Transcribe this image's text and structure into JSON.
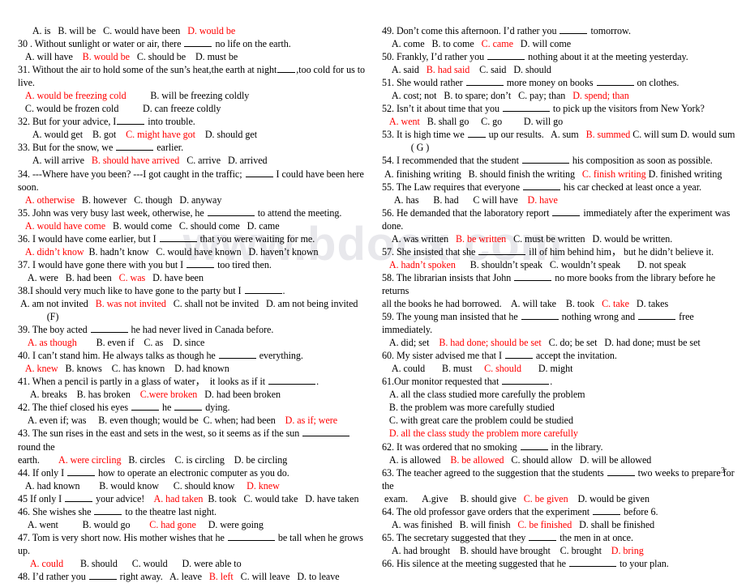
{
  "document": {
    "watermark": "www.bdocx.com",
    "page_number": "3",
    "accent_color": "#ff0000"
  },
  "left_column": [
    {
      "text": "      A. is   B. will be   C. would have been   ",
      "answer": "D. would be"
    },
    {
      "text": "30 . Without sunlight or water or air, there _____ no life on the earth."
    },
    {
      "text": "   A. will have    ",
      "answer": "B. would be",
      "tail": "   C. should be    D. must be"
    },
    {
      "text": "31. Without the air to hold some of the sun’s heat,the earth at night___,too cold for us to live."
    },
    {
      "answer": "   A. would be freezing cold",
      "tail": "          B. will be freezing coldly"
    },
    {
      "text": "   C. would be frozen cold          D. can freeze coldly"
    },
    {
      "text": "32. But for your advice, I_____ into trouble."
    },
    {
      "text": "      A. would get    B. got    ",
      "answer": "C. might have got",
      "tail": "    D. should get"
    },
    {
      "text": "33. But for the snow, we _______ earlier."
    },
    {
      "text": "      A. will arrive   ",
      "answer": "B. should have arrived",
      "tail": "   C. arrive   D. arrived"
    },
    {
      "text": "34. ---Where have you been? ---I got caught in the traffic; _____ I could have been here soon."
    },
    {
      "answer": "   A. otherwise",
      "tail": "   B. however   C. though   D. anyway"
    },
    {
      "text": "35. John was very busy last week, otherwise, he _________ to attend the meeting."
    },
    {
      "answer": "   A. would have come",
      "tail": "   B. would come   C. should come   D. came"
    },
    {
      "text": "36. I would have come earlier, but I ______ that you were waiting for me."
    },
    {
      "answer": "   A. didn’t know",
      "tail": "  B. hadn’t know   C. would have known   D. haven’t known"
    },
    {
      "text": "37. I would have gone there with you but I _____ too tired then."
    },
    {
      "text": "    A. were   B. had been   ",
      "answer": "C. was",
      "tail": "   D. have been"
    },
    {
      "text": "38.I should very much like to have gone to the party but I ______."
    },
    {
      "text": " A. am not invited   ",
      "answer": "B. was not invited",
      "tail": "   C. shall not be invited   D. am not being invited"
    },
    {
      "text": "            (F)"
    },
    {
      "text": "39. The boy acted ______ he had never lived in Canada before."
    },
    {
      "answer": "    A. as though",
      "tail": "        B. even if    C. as    D. since"
    },
    {
      "text": "40. I can’t stand him. He always talks as though he _______ everything."
    },
    {
      "answer": "   A. knew",
      "tail": "   B. knows    C. has known    D. had known"
    },
    {
      "text": "41. When a pencil is partly in a glass of water，  it looks as if it ________."
    },
    {
      "text": "     A. breaks    B. has broken    ",
      "answer": "C.were broken",
      "tail": "   D. had been broken"
    },
    {
      "text": "42. The thief closed his eyes _____ he _____ dying."
    },
    {
      "text": "    A. even if; was     B. even though; would be  C. when; had been    ",
      "answer": "D. as if; were"
    },
    {
      "text": "43. The sun rises in the east and sets in the west, so it seems as if the sun ________round the"
    },
    {
      "text": "earth.        ",
      "answer": "A. were circling",
      "tail": "   B. circles    C. is circling    D. be circling"
    },
    {
      "text": "44. If only I _____ how to operate an electronic computer as you do."
    },
    {
      "text": "   A. had known        B. would know      C. should know     ",
      "answer": "D. knew"
    },
    {
      "text": "45 If only I _____ your advice!    ",
      "answer": "A. had taken",
      "tail": "  B. took   C. would take   D. have taken"
    },
    {
      "text": "46. She wishes she ____ to the theatre last night."
    },
    {
      "text": "    A. went          B. would go        ",
      "answer": "C. had gone",
      "tail": "     D. were going"
    },
    {
      "text": "47. Tom is very short now. His mother wishes that he ________ be tall when he grows up."
    },
    {
      "answer": "     A. could",
      "tail": "       B. should      C. would      D. were able to"
    },
    {
      "text": "48. I’d rather you _____ right away.   A. leave   ",
      "answer": "B. left",
      "tail": "   C. will leave   D. to leave"
    }
  ],
  "right_column": [
    {
      "text": "49. Don’t come this afternoon. I’d rather you _____ tomorrow."
    },
    {
      "text": "    A. come   B. to come   ",
      "answer": "C. came",
      "tail": "   D. will come"
    },
    {
      "text": "50. Frankly, I’d rather you ______ nothing about it at the meeting yesterday."
    },
    {
      "text": "    A. said   ",
      "answer": "B. had said",
      "tail": "    C. said   D. should"
    },
    {
      "text": "51. She would rather _______ more money on books _______ on clothes."
    },
    {
      "text": "    A. cost; not   B. to spare; don’t   C. pay; than   ",
      "answer": "D. spend; than"
    },
    {
      "text": "52. Isn’t it about time that you ________ to pick up the visitors from New York?"
    },
    {
      "answer": "   A. went",
      "tail": "   B. shall go     C. go         D. will go"
    },
    {
      "text": "53. It is high time we ___ up our results.   A. sum   ",
      "answer": "B. summed",
      "tail": " C. will sum D. would sum"
    },
    {
      "text": "            ( G )"
    },
    {
      "text": "54. I recommended that the student ________ his composition as soon as possible."
    },
    {
      "text": " A. finishing writing   B. should finish the writing   ",
      "answer": "C. finish writing",
      "tail": " D. finished writing"
    },
    {
      "text": "55. The Law requires that everyone ______ his car checked at least once a year."
    },
    {
      "text": "     A. has      B. had      C will have    ",
      "answer": "D. have"
    },
    {
      "text": "56. He demanded that the laboratory report ____ immediately after the experiment was done."
    },
    {
      "text": "    A. was written   ",
      "answer": "B. be written",
      "tail": "   C. must be written   D. would be written."
    },
    {
      "text": "57. She insisted that she ________ ill of him behind him， but he didn’t believe it."
    },
    {
      "answer": "   A. hadn’t spoken",
      "tail": "      B. shouldn’t speak   C. wouldn’t speak       D. not speak"
    },
    {
      "text": "58. The librarian insists that John ______ no more books from the library before he returns"
    },
    {
      "text": "all the books he had borrowed.    A. will take    B. took   ",
      "answer": "C. take",
      "tail": "   D. takes"
    },
    {
      "text": "59. The young man insisted that he ______ nothing wrong and ______ free immediately."
    },
    {
      "text": "   A. did; set    ",
      "answer": "B. had done; should be set",
      "tail": "   C. do; be set   D. had done; must be set"
    },
    {
      "text": "60. My sister advised me that I _____ accept the invitation."
    },
    {
      "text": "    A. could       B. must     ",
      "answer": "C. should",
      "tail": "       D. might"
    },
    {
      "text": "61.Our monitor requested that ________."
    },
    {
      "text": "   A. all the class studied more carefully the problem"
    },
    {
      "text": "   B. the problem was more carefully studied"
    },
    {
      "text": "   C. with great care the problem could be studied"
    },
    {
      "answer": "   D. all the class study the problem more carefully"
    },
    {
      "text": "62. It was ordered that no smoking _____ in the library."
    },
    {
      "text": "   A. is allowed    ",
      "answer": "B. be allowed",
      "tail": "   C. should allow   D. will be allowed"
    },
    {
      "text": "63. The teacher agreed to the suggestion that the students _____ two weeks to prepare for the"
    },
    {
      "text": " exam.      A.give     B. should give   ",
      "answer": "C. be given",
      "tail": "    D. would be given"
    },
    {
      "text": "64. The old professor gave orders that the experiment _____ before 6."
    },
    {
      "text": "    A. was finished   B. will finish   ",
      "answer": "C. be finished",
      "tail": "   D. shall be finished"
    },
    {
      "text": "65. The secretary suggested that they _____ the men in at once."
    },
    {
      "text": "    A. had brought    B. should have brought    C. brought    ",
      "answer": "D. bring"
    },
    {
      "text": "66. His silence at the meeting suggested that he ________ to your plan."
    }
  ]
}
